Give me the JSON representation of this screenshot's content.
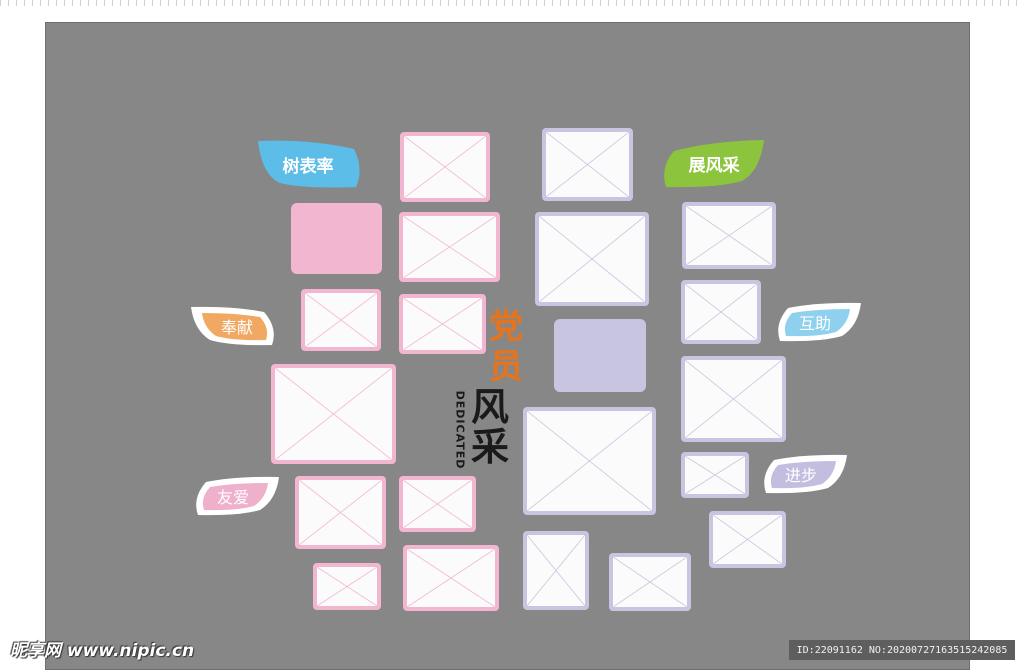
{
  "colors": {
    "background": "#878787",
    "pink": "#f2b6d1",
    "lavender": "#c8c5e0",
    "leaf_blue": "#5bbde8",
    "leaf_green": "#8cc43e",
    "leaf_orange": "#f0a862",
    "leaf_lightblue": "#8fd0ef",
    "leaf_pink": "#efb0cc",
    "leaf_lavender": "#c3bde0"
  },
  "leaves": {
    "shubiaoshuai": "树表率",
    "zhanfengcai": "展风采",
    "fengxian": "奉献",
    "huzhu": "互助",
    "youai": "友爱",
    "jinbu": "进步"
  },
  "title": {
    "dang": "党",
    "yuan": "员",
    "feng": "风",
    "cai": "采",
    "english": "DEDICATED"
  },
  "watermark": {
    "site": "昵享网 www.nipic.cn",
    "id": "ID:22091162 NO:20200727163515242085"
  }
}
